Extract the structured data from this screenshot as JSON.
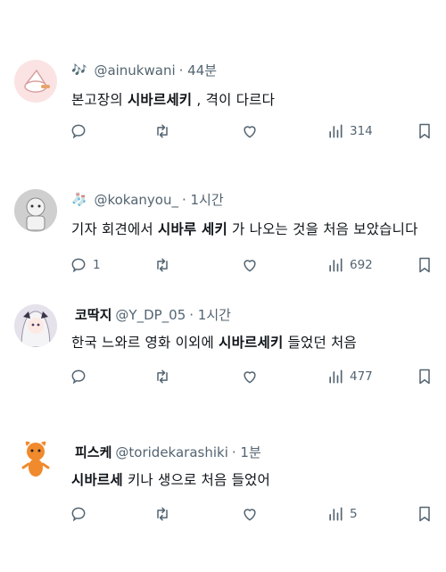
{
  "tweets": [
    {
      "badge": "🎶",
      "name": "",
      "handle": "@ainukwani",
      "time": "· 44분",
      "text_pre": "본고장의 ",
      "text_bold": "시바르세키",
      "text_post": " , 격이 다르다",
      "replies": "",
      "views": "314"
    },
    {
      "badge": "🧦",
      "name": "",
      "handle": "@kokanyou_",
      "time": "· 1시간",
      "text_pre": "기자 회견에서 ",
      "text_bold": "시바루 세키",
      "text_post": " 가 나오는 것을 처음 보았습니다",
      "replies": "1",
      "views": "692"
    },
    {
      "badge": "",
      "name": "코딱지",
      "handle": "@Y_DP_05",
      "time": "· 1시간",
      "text_pre": "한국 느와르 영화 이외에 ",
      "text_bold": "시바르세키",
      "text_post": " 들었던 처음",
      "replies": "",
      "views": "477"
    },
    {
      "badge": "",
      "name": "피스케",
      "handle": "@toridekarashiki",
      "time": "· 1분",
      "text_pre": "",
      "text_bold": "시바르세",
      "text_post": " 키나 생으로 처음 들었어",
      "replies": "",
      "views": "5"
    }
  ],
  "icons": {
    "reply": "reply-icon",
    "retweet": "retweet-icon",
    "like": "heart-icon",
    "views": "views-icon",
    "bookmark": "bookmark-icon"
  },
  "colors": {
    "text": "#0f1419",
    "muted": "#536471"
  }
}
